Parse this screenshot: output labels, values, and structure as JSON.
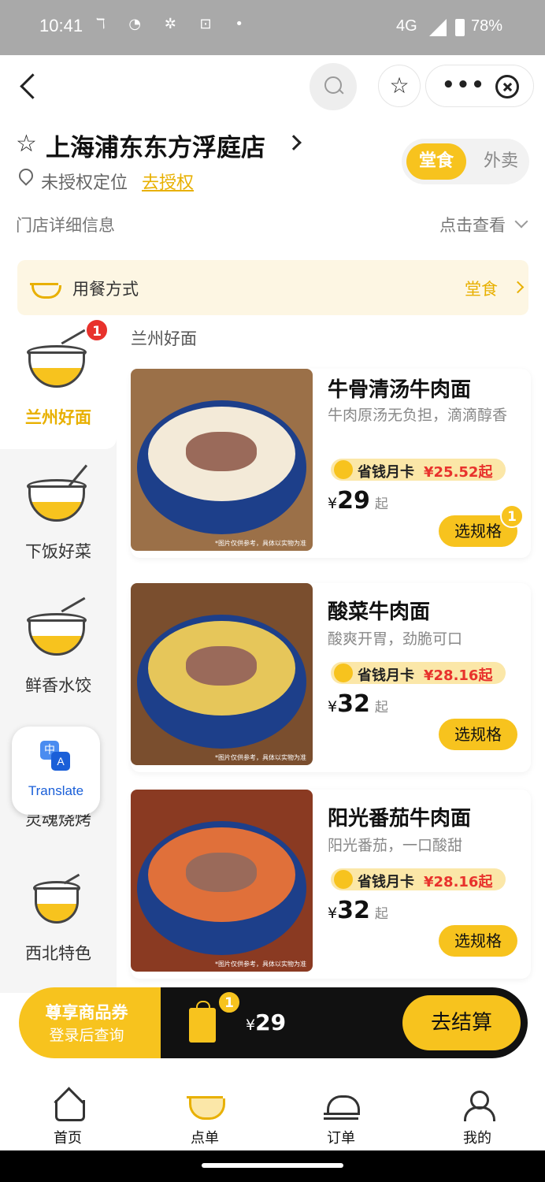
{
  "status_bar": {
    "time": "10:41",
    "icons": "ℸ ◔ ✲ ⊡ •",
    "network": "4G",
    "battery": "78%"
  },
  "nav": {
    "back_icon": "back-arrow-icon",
    "search_icon": "search-icon",
    "favorite_icon": "star-icon",
    "more_label": "•••",
    "close_icon": "close-circle-icon"
  },
  "store": {
    "name": "上海浦东东方浮庭店",
    "location_text": "未授权定位",
    "authorize_link": "去授权",
    "mode_dine_in": "堂食",
    "mode_takeout": "外卖",
    "detail_label": "门店详细信息",
    "detail_link": "点击查看"
  },
  "dining": {
    "label": "用餐方式",
    "value": "堂食"
  },
  "categories": [
    {
      "name": "兰州好面",
      "active": true,
      "badge": "1"
    },
    {
      "name": "下饭好菜"
    },
    {
      "name": "鲜香水饺"
    },
    {
      "name": "灵魂烧烤"
    },
    {
      "name": "西北特色"
    }
  ],
  "translate": {
    "label": "Translate",
    "icon_a": "中",
    "icon_b": "A"
  },
  "section_title": "兰州好面",
  "products": [
    {
      "title": "牛骨清汤牛肉面",
      "desc": "牛肉原汤无负担，滴滴醇香",
      "promo_label": "省钱月卡",
      "promo_price": "¥25.52起",
      "currency": "¥",
      "price": "29",
      "price_suffix": "起",
      "spec_button": "选规格",
      "spec_badge": "1",
      "note": "*图片仅供参考，具体以实物为准"
    },
    {
      "title": "酸菜牛肉面",
      "desc": "酸爽开胃，劲脆可口",
      "promo_label": "省钱月卡",
      "promo_price": "¥28.16起",
      "currency": "¥",
      "price": "32",
      "price_suffix": "起",
      "spec_button": "选规格",
      "note": "*图片仅供参考，具体以实物为准"
    },
    {
      "title": "阳光番茄牛肉面",
      "desc": "阳光番茄，一口酸甜",
      "promo_label": "省钱月卡",
      "promo_price": "¥28.16起",
      "currency": "¥",
      "price": "32",
      "price_suffix": "起",
      "spec_button": "选规格",
      "note": "*图片仅供参考，具体以实物为准"
    }
  ],
  "cart": {
    "coupon_line1": "尊享商品券",
    "coupon_line2": "登录后查询",
    "badge": "1",
    "currency": "¥",
    "total": "29",
    "checkout_label": "去结算"
  },
  "tabs": [
    {
      "label": "首页",
      "icon": "home-icon"
    },
    {
      "label": "点单",
      "icon": "order-bowl-icon"
    },
    {
      "label": "订单",
      "icon": "receipt-icon"
    },
    {
      "label": "我的",
      "icon": "profile-icon"
    }
  ],
  "colors": {
    "accent": "#f7c31e",
    "accent_text": "#e8b000",
    "price_red": "#e8322c"
  }
}
